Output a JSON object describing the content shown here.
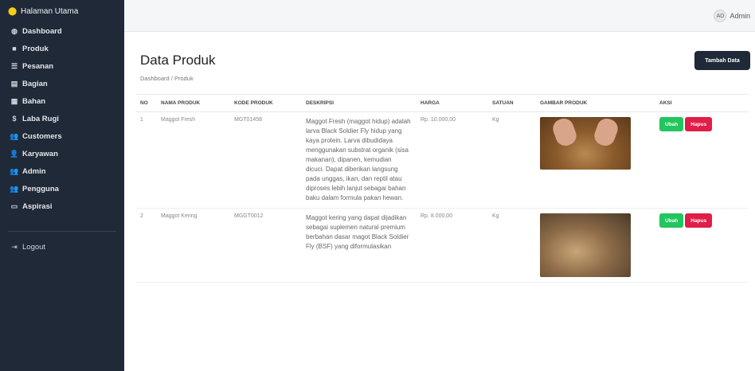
{
  "sidebar": {
    "home": "Halaman Utama",
    "items": [
      {
        "label": "Dashboard",
        "icon": "dashboard-icon",
        "glyph": "◍"
      },
      {
        "label": "Produk",
        "icon": "produk-icon",
        "glyph": "■"
      },
      {
        "label": "Pesanan",
        "icon": "pesanan-icon",
        "glyph": "☰"
      },
      {
        "label": "Bagian",
        "icon": "bagian-icon",
        "glyph": "▤"
      },
      {
        "label": "Bahan",
        "icon": "bahan-icon",
        "glyph": "▦"
      },
      {
        "label": "Laba Rugi",
        "icon": "laba-rugi-icon",
        "glyph": "$"
      },
      {
        "label": "Customers",
        "icon": "customers-icon",
        "glyph": "👥"
      },
      {
        "label": "Karyawan",
        "icon": "karyawan-icon",
        "glyph": "👤"
      },
      {
        "label": "Admin",
        "icon": "admin-icon",
        "glyph": "👥"
      },
      {
        "label": "Pengguna",
        "icon": "pengguna-icon",
        "glyph": "👥"
      },
      {
        "label": "Aspirasi",
        "icon": "aspirasi-icon",
        "glyph": "▭"
      }
    ],
    "logout": "Logout"
  },
  "topbar": {
    "user_initials": "AD",
    "user_name": "Admin"
  },
  "page": {
    "title": "Data Produk",
    "breadcrumb": "Dashboard / Produk",
    "add_button": "Tambah Data"
  },
  "table": {
    "headers": [
      "NO",
      "NAMA PRODUK",
      "KODE PRODUK",
      "DESKRIPSI",
      "HARGA",
      "SATUAN",
      "GAMBAR PRODUK",
      "AKSI"
    ],
    "rows": [
      {
        "no": "1",
        "name": "Maggot Fresh",
        "code": "MGT01458",
        "desc": "Maggot Fresh (maggot hidup) adalah larva Black Soldier Fly hidup yang kaya protein. Larva dibudidaya menggunakan substrat organik (sisa makanan), dipanen, kemudian dicuci. Dapat diberikan langsung pada unggas, ikan, dan reptil atau diproses lebih lanjut sebagai bahan baku dalam formula pakan hewan.",
        "price": "Rp. 10.000,00",
        "unit": "Kg",
        "edit": "Ubah",
        "delete": "Hapus"
      },
      {
        "no": "2",
        "name": "Maggot Kering",
        "code": "MGGT0012",
        "desc": "Maggot kering yang dapat dijadikan sebagai suplemen natural premium berbahan dasar magot Black Soldier Fly (BSF) yang diformulasikan",
        "price": "Rp. 8.000,00",
        "unit": "Kg",
        "edit": "Ubah",
        "delete": "Hapus"
      }
    ]
  }
}
